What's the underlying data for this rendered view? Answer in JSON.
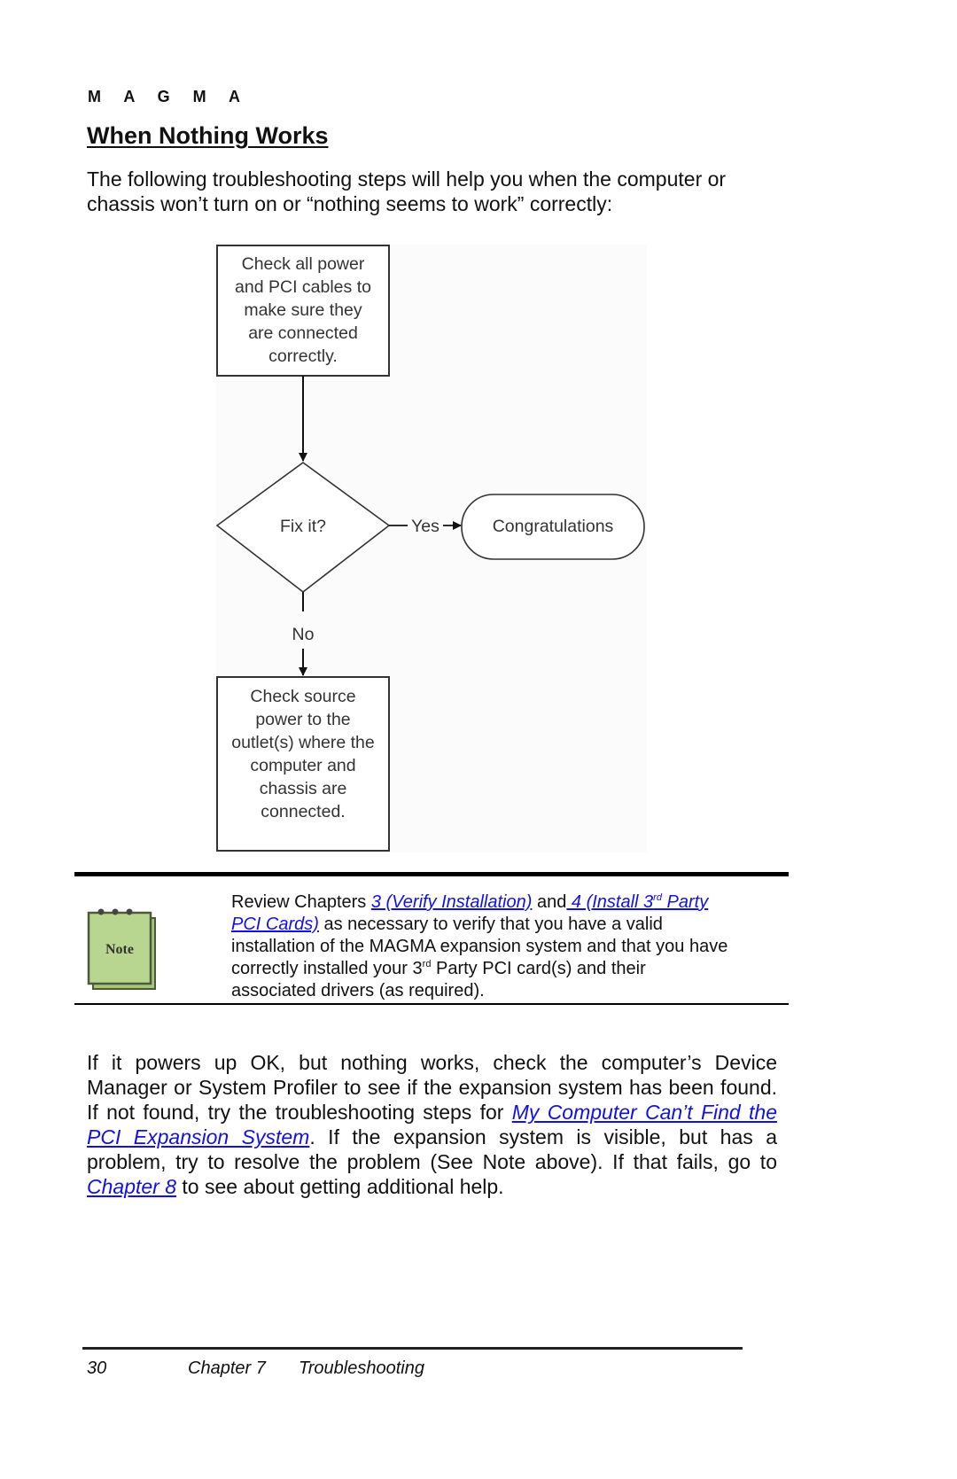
{
  "header": {
    "brand": "M A G M A",
    "title": "When Nothing Works"
  },
  "intro": {
    "line1": "The following troubleshooting steps will help you when the computer or",
    "line2": "chassis won’t turn on or “nothing seems to work” correctly:"
  },
  "flowchart": {
    "step1": [
      "Check all power",
      "and PCI cables to",
      "make sure they",
      "are connected",
      "correctly."
    ],
    "decision": "Fix it?",
    "yes_label": "Yes",
    "no_label": "No",
    "terminal": "Congratulations",
    "step2": [
      "Check source",
      "power to the",
      "outlet(s) where the",
      "computer and",
      "chassis are",
      "connected."
    ]
  },
  "note": {
    "icon_label": "Note",
    "text_prefix": "Review Chapters ",
    "link1": "3 (Verify Installation)",
    "and": " and",
    "link2_part1": " 4 (Install 3",
    "link2_sup": "rd",
    "link2_part2": " Party",
    "link2_part3": "PCI Cards)",
    "text_rest1": " as necessary to verify that you have a valid",
    "line3": "installation of the MAGMA expansion system and that you have",
    "line4_pre": "correctly installed your 3",
    "line4_sup": "rd",
    "line4_post": " Party PCI card(s) and their",
    "line5": "associated drivers (as required)."
  },
  "body": {
    "text1": "If it powers up OK, but nothing works, check the computer’s Device Manager or System Profiler to see if the expansion system has been found. If not found, try the troubleshooting steps for ",
    "link1": "My Computer Can’t Find the PCI Expansion System",
    "text2": ". If the expansion system is visible, but has a problem, try to resolve the problem (See Note above). If that fails, go to ",
    "link2": "Chapter 8",
    "text3": " to see about getting additional help."
  },
  "footer": {
    "page_number": "30",
    "chapter": "Chapter 7",
    "section": "Troubleshooting"
  },
  "colors": {
    "link": "#1010ee",
    "note_green": "#b5d48c"
  }
}
